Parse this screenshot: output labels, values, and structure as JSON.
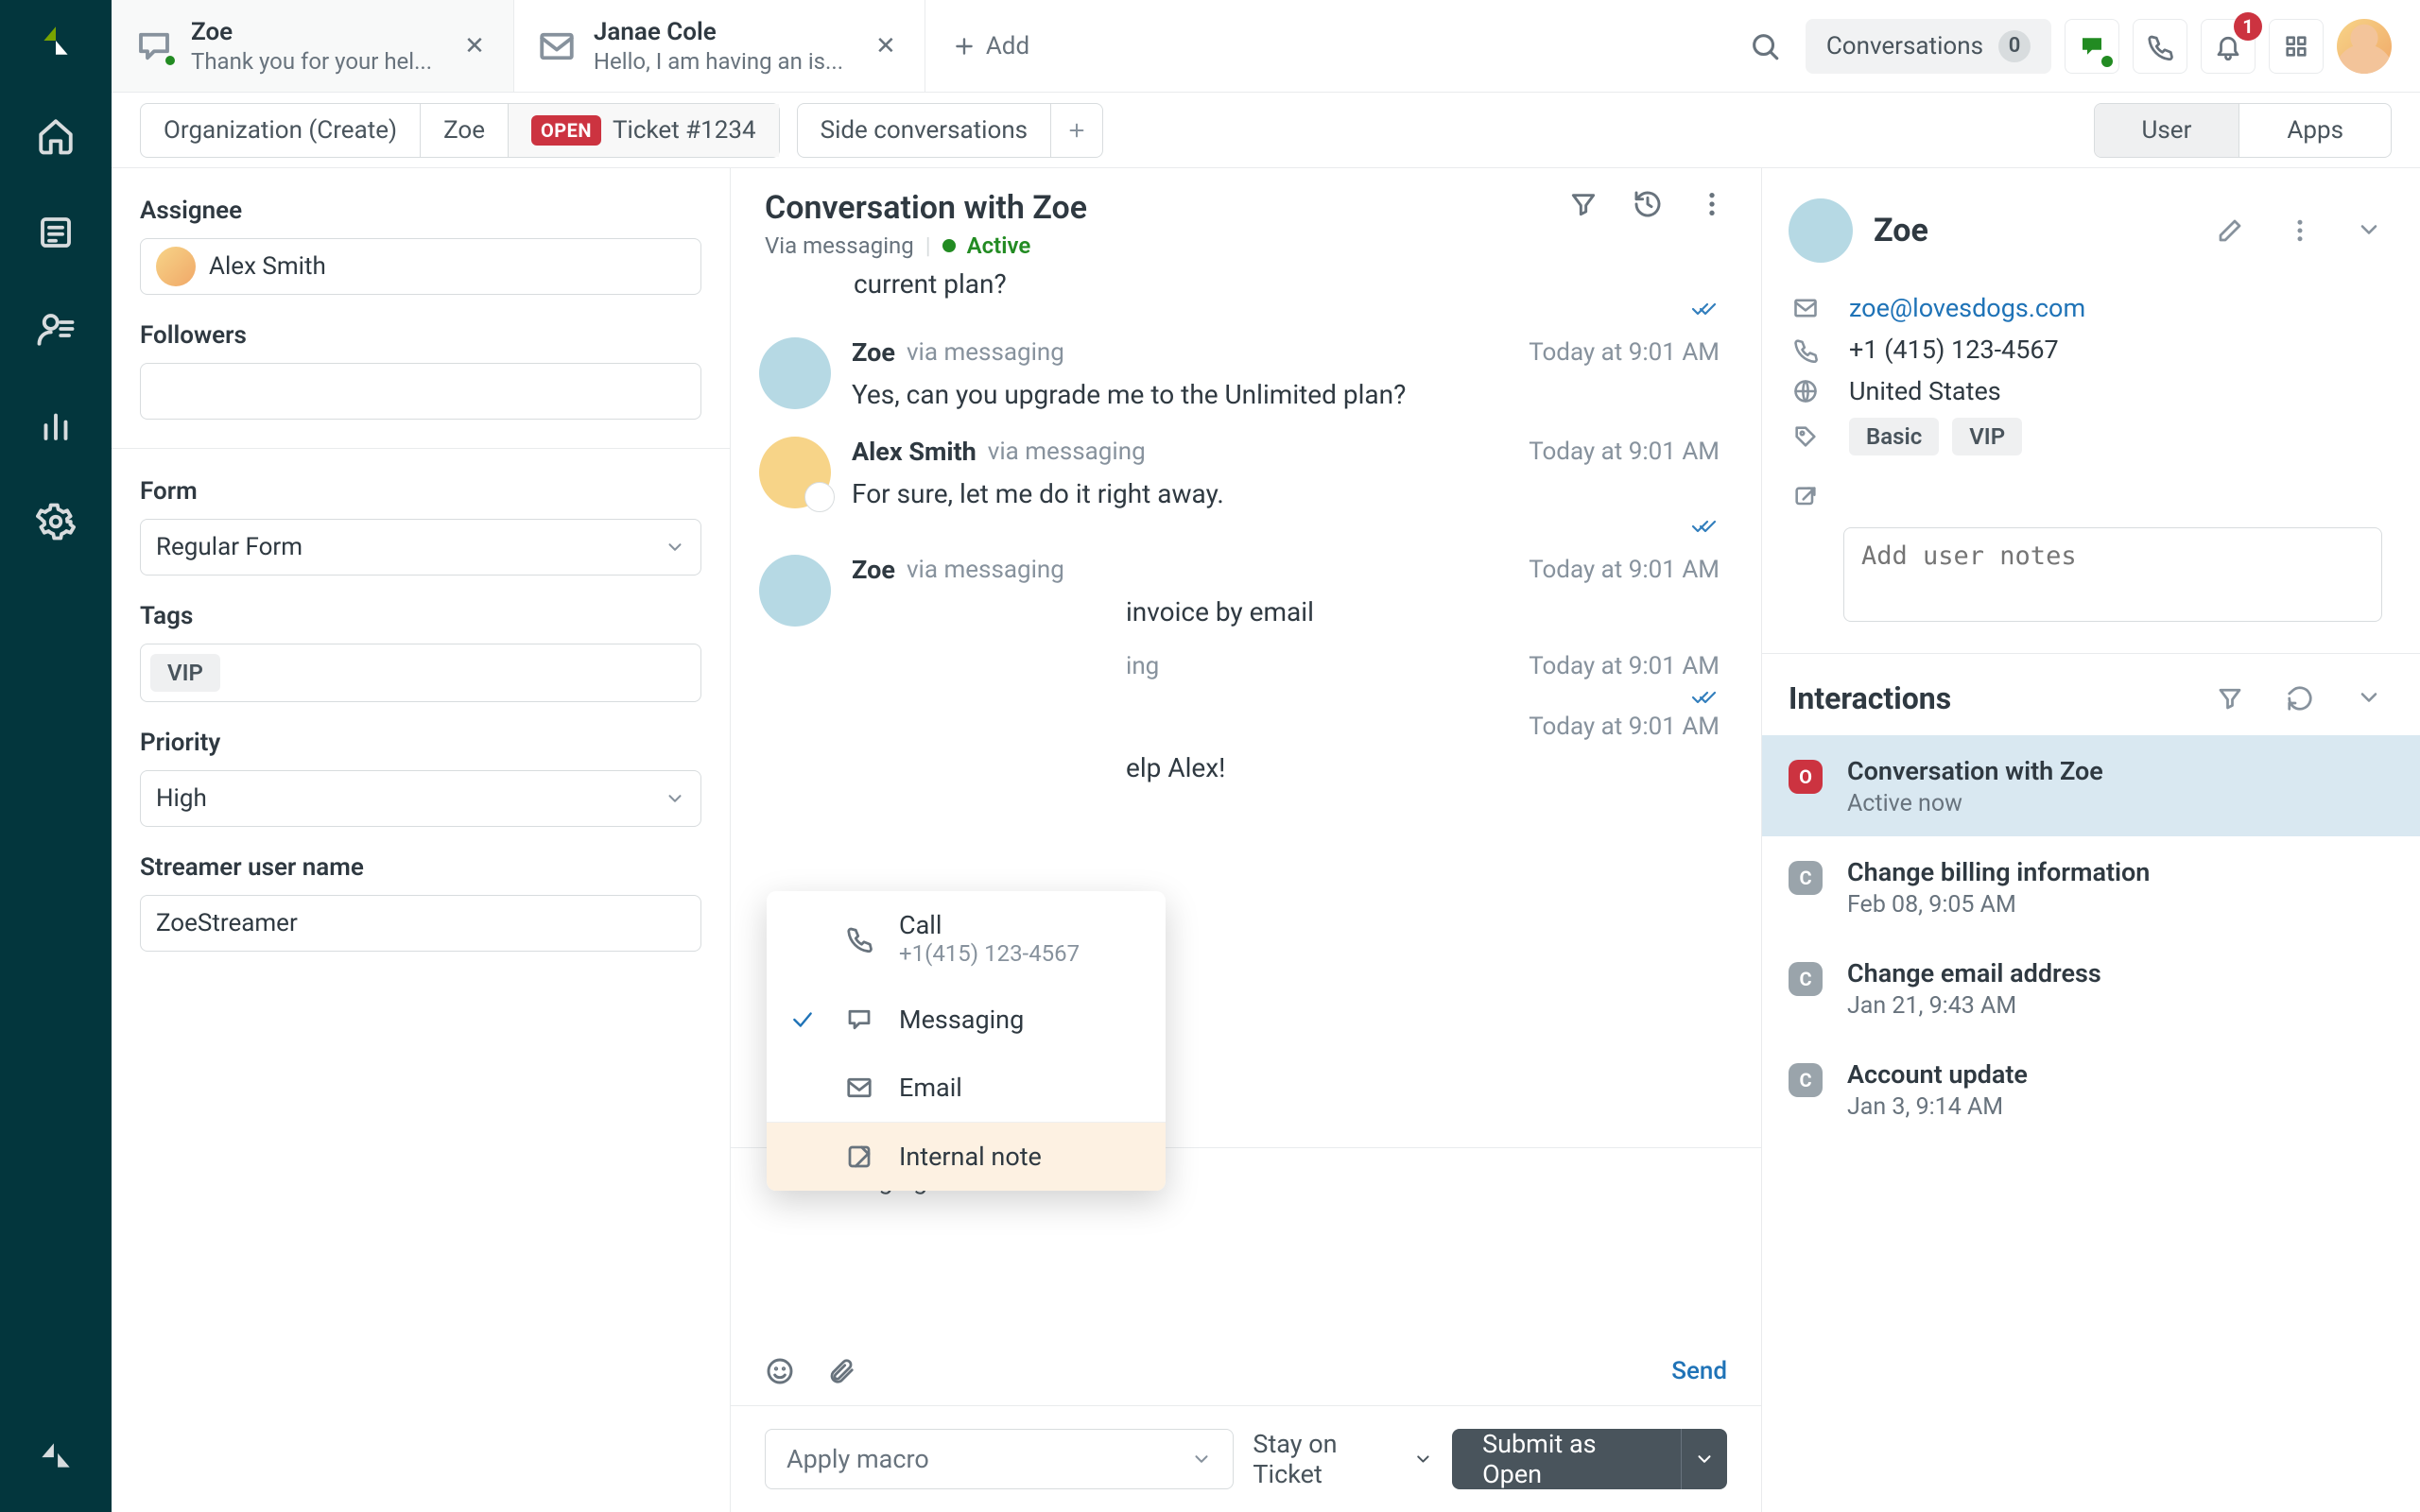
{
  "tabs": [
    {
      "title": "Zoe",
      "subtitle": "Thank you for your hel..."
    },
    {
      "title": "Janae Cole",
      "subtitle": "Hello, I am having an is..."
    }
  ],
  "add_tab_label": "Add",
  "topbar": {
    "conversations_label": "Conversations",
    "conversations_count": "0",
    "notifications_count": "1"
  },
  "breadcrumb": {
    "org": "Organization (Create)",
    "user": "Zoe",
    "status": "OPEN",
    "ticket": "Ticket #1234",
    "side_conversations": "Side conversations"
  },
  "segmented": {
    "user": "User",
    "apps": "Apps"
  },
  "properties": {
    "assignee_label": "Assignee",
    "assignee_value": "Alex Smith",
    "followers_label": "Followers",
    "form_label": "Form",
    "form_value": "Regular Form",
    "tags_label": "Tags",
    "tags": [
      "VIP"
    ],
    "priority_label": "Priority",
    "priority_value": "High",
    "streamer_label": "Streamer user name",
    "streamer_value": "ZoeStreamer"
  },
  "conversation": {
    "title": "Conversation with Zoe",
    "via": "Via messaging",
    "status": "Active",
    "partial_first_line": "current plan?",
    "messages": [
      {
        "who": "Zoe",
        "via": "via messaging",
        "ts": "Today at 9:01 AM",
        "text": "Yes, can you upgrade me to the Unlimited plan?",
        "avatar": "zoe"
      },
      {
        "who": "Alex Smith",
        "via": "via messaging",
        "ts": "Today at 9:01 AM",
        "text": "For sure, let me do it right away.",
        "avatar": "alex",
        "delivered": true
      },
      {
        "who": "Zoe",
        "via": "via messaging",
        "ts": "Today at 9:01 AM",
        "text": "invoice by email",
        "avatar": "zoe",
        "truncated": true
      },
      {
        "who_hidden": true,
        "via": "ing",
        "ts": "Today at 9:01 AM",
        "delivered": true
      },
      {
        "who_hidden": true,
        "ts": "Today at 9:01 AM",
        "text_suffix": "elp Alex!"
      }
    ],
    "composer_channel": "Messaging",
    "send_label": "Send"
  },
  "channel_menu": {
    "call_label": "Call",
    "call_sub": "+1(415) 123-4567",
    "messaging_label": "Messaging",
    "email_label": "Email",
    "internal_label": "Internal note"
  },
  "footer": {
    "macro": "Apply macro",
    "stay": "Stay on Ticket",
    "submit": "Submit as Open"
  },
  "user_panel": {
    "name": "Zoe",
    "email": "zoe@lovesdogs.com",
    "phone": "+1 (415) 123-4567",
    "location": "United States",
    "tags": [
      "Basic",
      "VIP"
    ],
    "notes_placeholder": "Add user notes"
  },
  "interactions": {
    "title": "Interactions",
    "items": [
      {
        "status": "open",
        "badge": "O",
        "title": "Conversation with Zoe",
        "sub": "Active now"
      },
      {
        "status": "closed",
        "badge": "C",
        "title": "Change billing information",
        "sub": "Feb 08, 9:05 AM"
      },
      {
        "status": "closed",
        "badge": "C",
        "title": "Change email address",
        "sub": "Jan 21, 9:43 AM"
      },
      {
        "status": "closed",
        "badge": "C",
        "title": "Account update",
        "sub": "Jan 3, 9:14 AM"
      }
    ]
  }
}
